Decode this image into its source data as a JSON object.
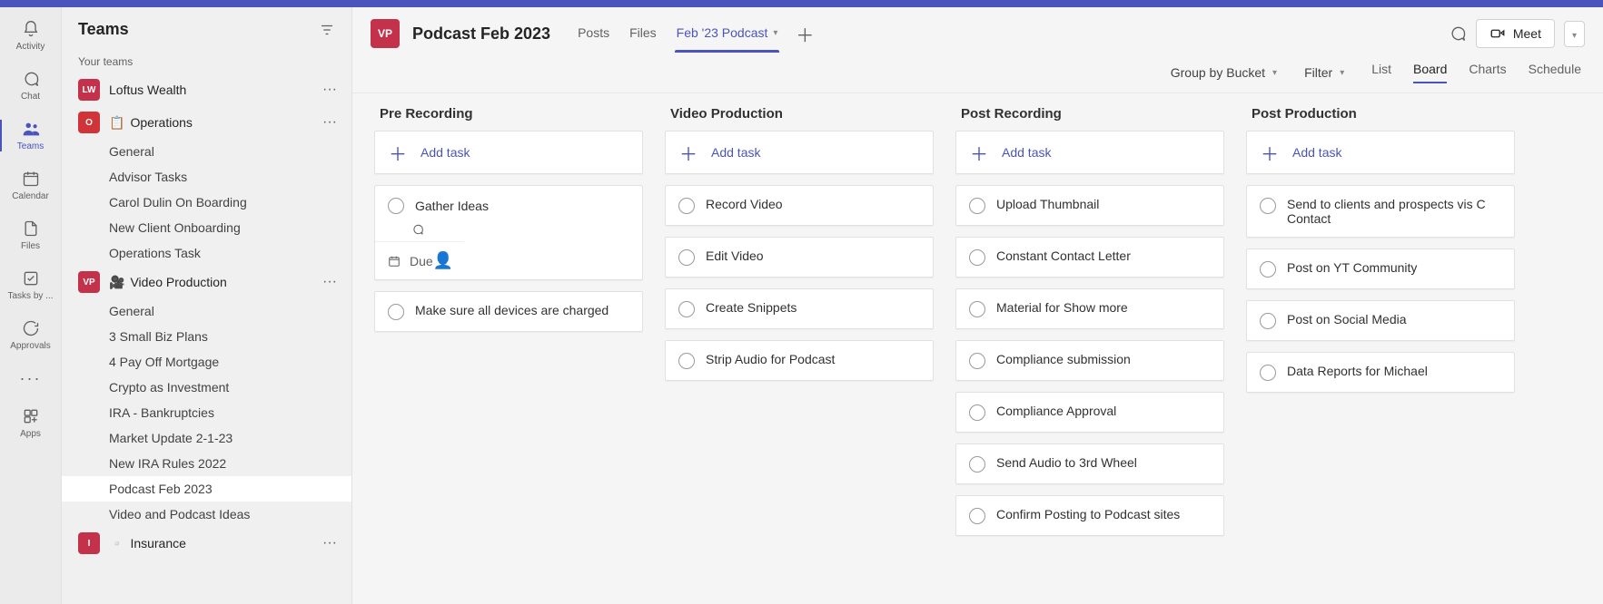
{
  "rail": {
    "items": [
      {
        "id": "activity",
        "label": "Activity"
      },
      {
        "id": "chat",
        "label": "Chat"
      },
      {
        "id": "teams",
        "label": "Teams"
      },
      {
        "id": "calendar",
        "label": "Calendar"
      },
      {
        "id": "files",
        "label": "Files"
      },
      {
        "id": "tasks",
        "label": "Tasks by ..."
      },
      {
        "id": "approvals",
        "label": "Approvals"
      },
      {
        "id": "more",
        "label": ""
      },
      {
        "id": "apps",
        "label": "Apps"
      }
    ]
  },
  "sidepanel": {
    "title": "Teams",
    "section": "Your teams",
    "teams": [
      {
        "initials": "LW",
        "name": "Loftus Wealth",
        "avatarClass": "av-red",
        "channels": []
      },
      {
        "initials": "O",
        "name": "Operations",
        "avatarClass": "av-ored",
        "emoji": "📋",
        "channels": [
          "General",
          "Advisor Tasks",
          "Carol Dulin On Boarding",
          "New Client Onboarding",
          "Operations Task"
        ]
      },
      {
        "initials": "VP",
        "name": "Video Production",
        "avatarClass": "av-red",
        "emoji": "🎥",
        "channels": [
          "General",
          "3 Small Biz Plans",
          "4 Pay Off Mortgage",
          "Crypto as Investment",
          "IRA - Bankruptcies",
          "Market Update 2-1-23",
          "New IRA Rules 2022",
          "Podcast Feb 2023",
          "Video and Podcast Ideas"
        ],
        "activeChannel": "Podcast Feb 2023"
      },
      {
        "initials": "I",
        "name": "Insurance",
        "avatarClass": "av-red",
        "emoji": "▫️",
        "channels": []
      }
    ]
  },
  "header": {
    "avatar": "VP",
    "title": "Podcast Feb 2023",
    "tabs": [
      "Posts",
      "Files"
    ],
    "activeTab": "Feb '23 Podcast",
    "meet": "Meet"
  },
  "planner": {
    "groupBy": "Group by Bucket",
    "filter": "Filter",
    "views": [
      "List",
      "Board",
      "Charts",
      "Schedule"
    ],
    "activeView": "Board"
  },
  "buckets": [
    {
      "title": "Pre Recording",
      "addLabel": "Add task",
      "cards": [
        {
          "title": "Gather Ideas",
          "expanded": true,
          "due": "Due"
        },
        {
          "title": "Make sure all devices are charged"
        }
      ]
    },
    {
      "title": "Video Production",
      "addLabel": "Add task",
      "cards": [
        {
          "title": "Record Video"
        },
        {
          "title": "Edit Video"
        },
        {
          "title": "Create Snippets"
        },
        {
          "title": "Strip Audio for Podcast"
        }
      ]
    },
    {
      "title": "Post Recording",
      "addLabel": "Add task",
      "cards": [
        {
          "title": "Upload Thumbnail"
        },
        {
          "title": "Constant Contact Letter"
        },
        {
          "title": "Material for Show more"
        },
        {
          "title": "Compliance submission"
        },
        {
          "title": "Compliance Approval"
        },
        {
          "title": "Send Audio to 3rd Wheel"
        },
        {
          "title": "Confirm Posting to Podcast sites"
        }
      ]
    },
    {
      "title": "Post Production",
      "addLabel": "Add task",
      "cards": [
        {
          "title": "Send to clients and prospects vis C Contact"
        },
        {
          "title": "Post on YT Community"
        },
        {
          "title": "Post on Social Media"
        },
        {
          "title": "Data Reports for Michael"
        }
      ]
    }
  ]
}
